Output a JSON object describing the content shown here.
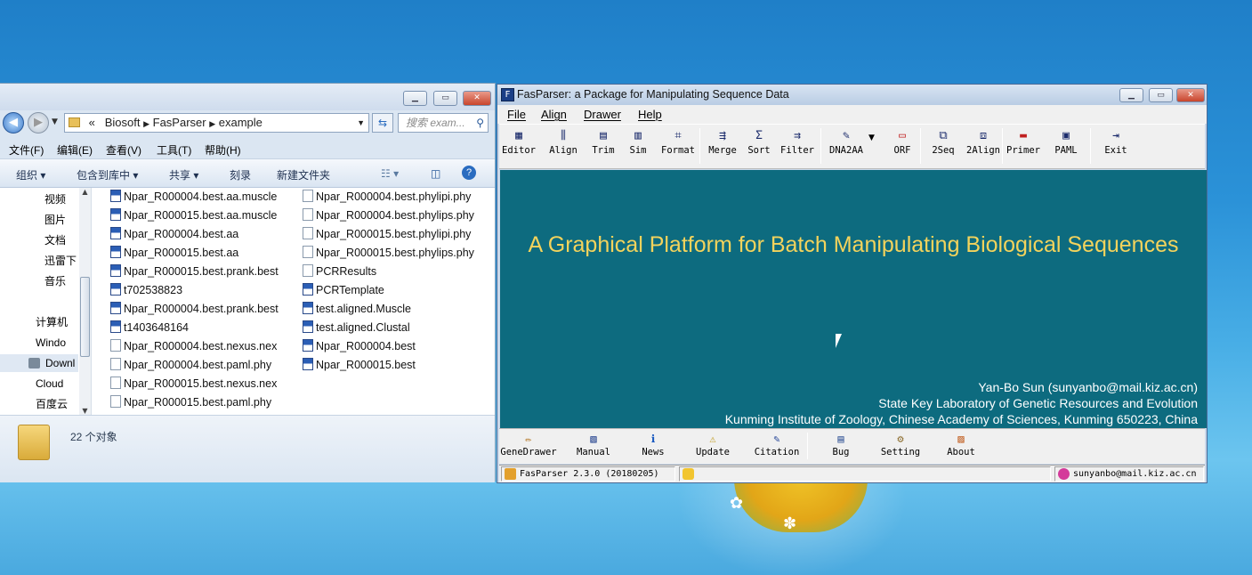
{
  "explorer": {
    "address": {
      "sep": "«",
      "crumbs": [
        "Biosoft",
        "FasParser",
        "example"
      ]
    },
    "search_placeholder": "搜索 exam...",
    "menu": [
      "文件(F)",
      "编辑(E)",
      "查看(V)",
      "工具(T)",
      "帮助(H)"
    ],
    "commands": [
      "组织 ▾",
      "包含到库中 ▾",
      "共享 ▾",
      "刻录",
      "新建文件夹"
    ],
    "nav": [
      "视频",
      "图片",
      "文档",
      "迅雷下",
      "音乐",
      "计算机",
      "Windo",
      "Downl",
      "Cloud",
      "百度云"
    ],
    "files_col1": [
      "Npar_R000004.best.aa.muscle",
      "Npar_R000015.best.aa.muscle",
      "Npar_R000004.best.aa",
      "Npar_R000015.best.aa",
      "Npar_R000015.best.prank.best",
      "t702538823",
      "Npar_R000004.best.prank.best",
      "t1403648164",
      "Npar_R000004.best.nexus.nex",
      "Npar_R000004.best.paml.phy",
      "Npar_R000015.best.nexus.nex",
      "Npar_R000015.best.paml.phy"
    ],
    "files_col2": [
      "Npar_R000004.best.phylipi.phy",
      "Npar_R000004.best.phylips.phy",
      "Npar_R000015.best.phylipi.phy",
      "Npar_R000015.best.phylips.phy",
      "PCRResults",
      "PCRTemplate",
      "test.aligned.Muscle",
      "test.aligned.Clustal",
      "Npar_R000004.best",
      "Npar_R000015.best"
    ],
    "status_count": "22 个对象"
  },
  "fas": {
    "title": "FasParser: a Package for Manipulating Sequence Data",
    "menu": [
      "File",
      "Align",
      "Drawer",
      "Help"
    ],
    "toolbar": [
      "Editor",
      "Align",
      "Trim",
      "Sim",
      "Format",
      "Merge",
      "Sort",
      "Filter",
      "DNA2AA",
      "ORF",
      "2Seq",
      "2Align",
      "Primer",
      "PAML",
      "Exit"
    ],
    "headline": "A Graphical Platform for Batch Manipulating Biological Sequences",
    "credits": [
      "Yan-Bo Sun (sunyanbo@mail.kiz.ac.cn)",
      "State Key Laboratory of Genetic Resources and Evolution",
      "Kunming Institute of Zoology, Chinese Academy of Sciences, Kunming 650223, China"
    ],
    "bottom": [
      "GeneDrawer",
      "Manual",
      "News",
      "Update",
      "Citation",
      "Bug",
      "Setting",
      "About"
    ],
    "status": {
      "version": "FasParser 2.3.0 (20180205)",
      "email": "sunyanbo@mail.kiz.ac.cn"
    },
    "colors": {
      "canvas": "#0d6b7f",
      "headline": "#f3d35c"
    }
  }
}
